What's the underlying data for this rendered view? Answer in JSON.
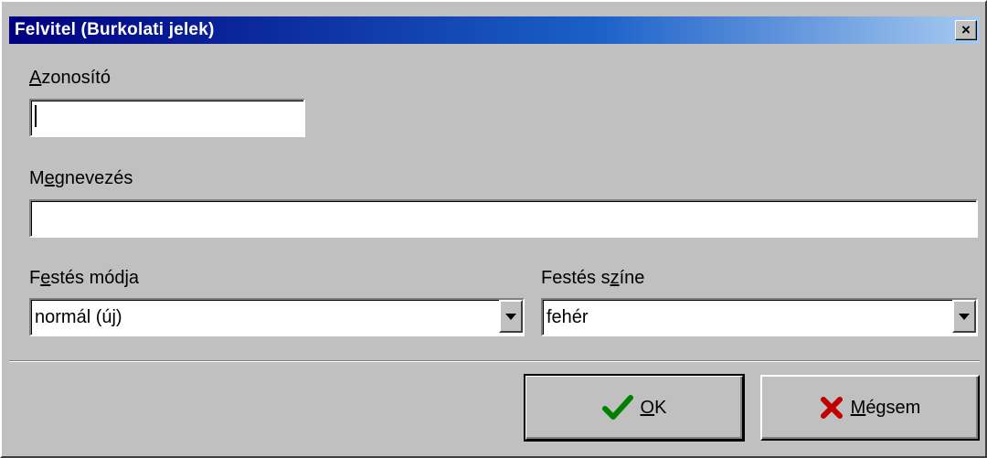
{
  "window": {
    "title": "Felvitel (Burkolati jelek)",
    "close_label": "×"
  },
  "fields": {
    "azonosito": {
      "label_access": "A",
      "label_rest": "zonosító",
      "value": ""
    },
    "megnevezes": {
      "label_pre": "M",
      "label_access": "e",
      "label_rest": "gnevezés",
      "value": ""
    },
    "festes_modja": {
      "label_pre": "F",
      "label_access": "e",
      "label_rest": "stés módja",
      "value": "normál (új)"
    },
    "festes_szine": {
      "label_pre": "Festés s",
      "label_access": "z",
      "label_rest": "íne",
      "value": "fehér"
    }
  },
  "buttons": {
    "ok": {
      "access": "O",
      "rest": "K",
      "icon": "checkmark-icon",
      "icon_color": "#008000"
    },
    "cancel": {
      "access": "M",
      "rest": "égsem",
      "icon": "x-icon",
      "icon_color": "#c00000"
    }
  }
}
